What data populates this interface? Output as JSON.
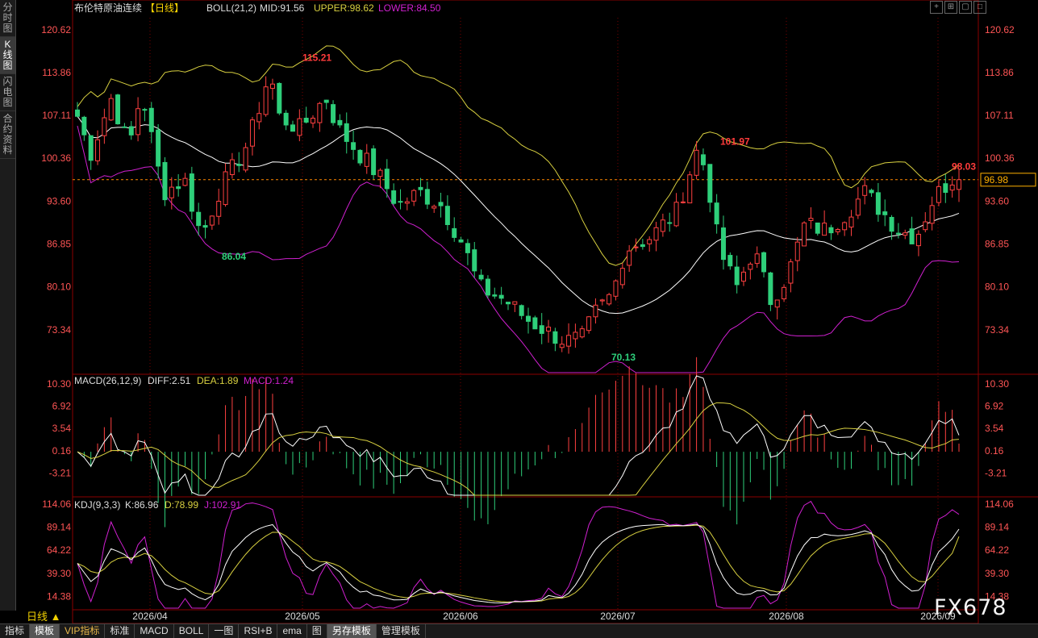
{
  "sidebar": {
    "items": [
      "分时图",
      "K线图",
      "闪电图",
      "合约资料"
    ]
  },
  "main_title": {
    "name": "布伦特原油连续",
    "period": "【日线】",
    "indicator": "BOLL(21,2)",
    "mid": "MID:91.56",
    "upper": "UPPER:98.62",
    "lower": "LOWER:84.50"
  },
  "macd_title": {
    "name": "MACD(26,12,9)",
    "diff": "DIFF:2.51",
    "dea": "DEA:1.89",
    "macd": "MACD:1.24"
  },
  "kdj_title": {
    "name": "KDJ(9,3,3)",
    "k": "K:86.96",
    "d": "D:78.99",
    "j": "J:102.91"
  },
  "price_box": "96.98",
  "period_label": "日线 ▲",
  "bottom_tabs": [
    "指标",
    "模板",
    "VIP指标",
    "标准",
    "MACD",
    "BOLL",
    "一图",
    "RSI+B",
    "ema",
    "图",
    "另存模板",
    "管理模板"
  ],
  "watermark": "FX678",
  "window_controls": [
    "+",
    "⊞",
    "▢",
    "□"
  ],
  "colors": {
    "up": "#ff4040",
    "down": "#2ecf7a",
    "mid": "#ffffff",
    "upper": "#d8d040",
    "lower": "#d020d0",
    "grid": "#8b0000",
    "axis": "#ff5555"
  },
  "chart_data": [
    {
      "type": "candlestick",
      "title": "布伦特原油连续【日线】",
      "ylim": [
        66.58,
        120.62
      ],
      "y_ticks": [
        "120.62",
        "113.86",
        "107.11",
        "100.36",
        "93.60",
        "86.85",
        "80.10",
        "73.34"
      ],
      "x_ticks": [
        "2026/04",
        "2026/05",
        "2026/06",
        "2026/07",
        "2026/08",
        "2026/09"
      ],
      "annotations": [
        {
          "text": "115.21",
          "value": 115.21
        },
        {
          "text": "86.04",
          "value": 86.04
        },
        {
          "text": "101.97",
          "value": 101.97
        },
        {
          "text": "70.13",
          "value": 70.13
        },
        {
          "text": "98.03",
          "value": 98.03
        }
      ],
      "last_price": 96.98
    },
    {
      "type": "bar",
      "title": "MACD(26,12,9)",
      "ylim": [
        -6.59,
        11.5
      ],
      "y_ticks": [
        "10.30",
        "6.92",
        "3.54",
        "0.16",
        "-3.21"
      ],
      "series": [
        {
          "name": "DIFF",
          "last": 2.51
        },
        {
          "name": "DEA",
          "last": 1.89
        },
        {
          "name": "MACD",
          "last": 1.24
        }
      ]
    },
    {
      "type": "line",
      "title": "KDJ(9,3,3)",
      "ylim": [
        0,
        120
      ],
      "y_ticks": [
        "114.06",
        "89.14",
        "64.22",
        "39.30",
        "14.38"
      ],
      "series": [
        {
          "name": "K",
          "last": 86.96
        },
        {
          "name": "D",
          "last": 78.99
        },
        {
          "name": "J",
          "last": 102.91
        }
      ]
    }
  ]
}
